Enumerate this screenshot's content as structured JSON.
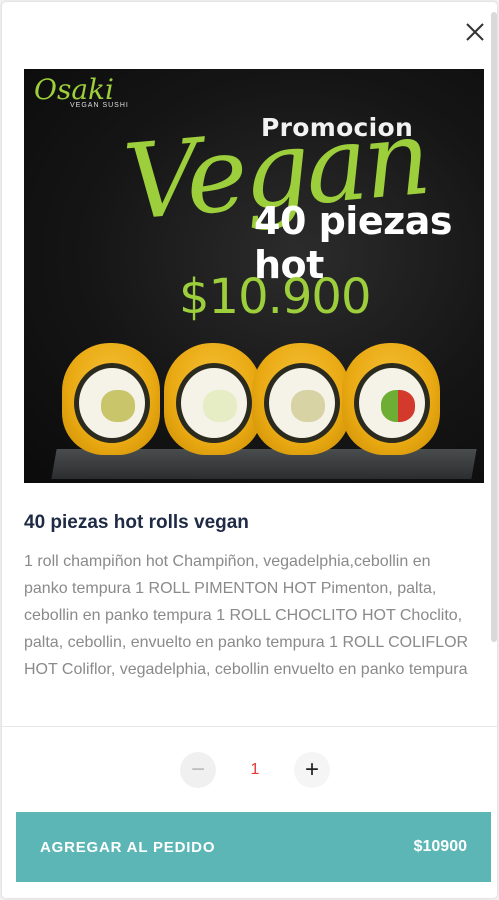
{
  "product": {
    "image": {
      "logo_text": "Osaki",
      "logo_subtext": "VEGAN SUSHI",
      "promo_line": "Promocion",
      "headline": "Vegan",
      "subheadline": "40 piezas hot",
      "price_text": "$10.900"
    },
    "title": "40 piezas hot rolls vegan",
    "description": "1 roll champiñon hot Champiñon, vegadelphia,cebollin en panko tempura 1 ROLL PIMENTON HOT Pimenton, palta, cebollin en panko tempura 1 ROLL CHOCLITO HOT Choclito, palta, cebollin, envuelto en panko tempura 1 ROLL COLIFLOR HOT Coliflor, vegadelphia, cebollin envuelto en panko tempura"
  },
  "quantity": {
    "minus_symbol": "−",
    "value": "1",
    "plus_symbol": "+"
  },
  "add_button": {
    "label": "AGREGAR AL PEDIDO",
    "price": "$10900"
  },
  "colors": {
    "accent": "#5db6b6",
    "quantity_text": "#e53935",
    "title": "#1f2a44",
    "brand_green": "#9ccf3b"
  },
  "icons": {
    "close": "close-icon"
  }
}
